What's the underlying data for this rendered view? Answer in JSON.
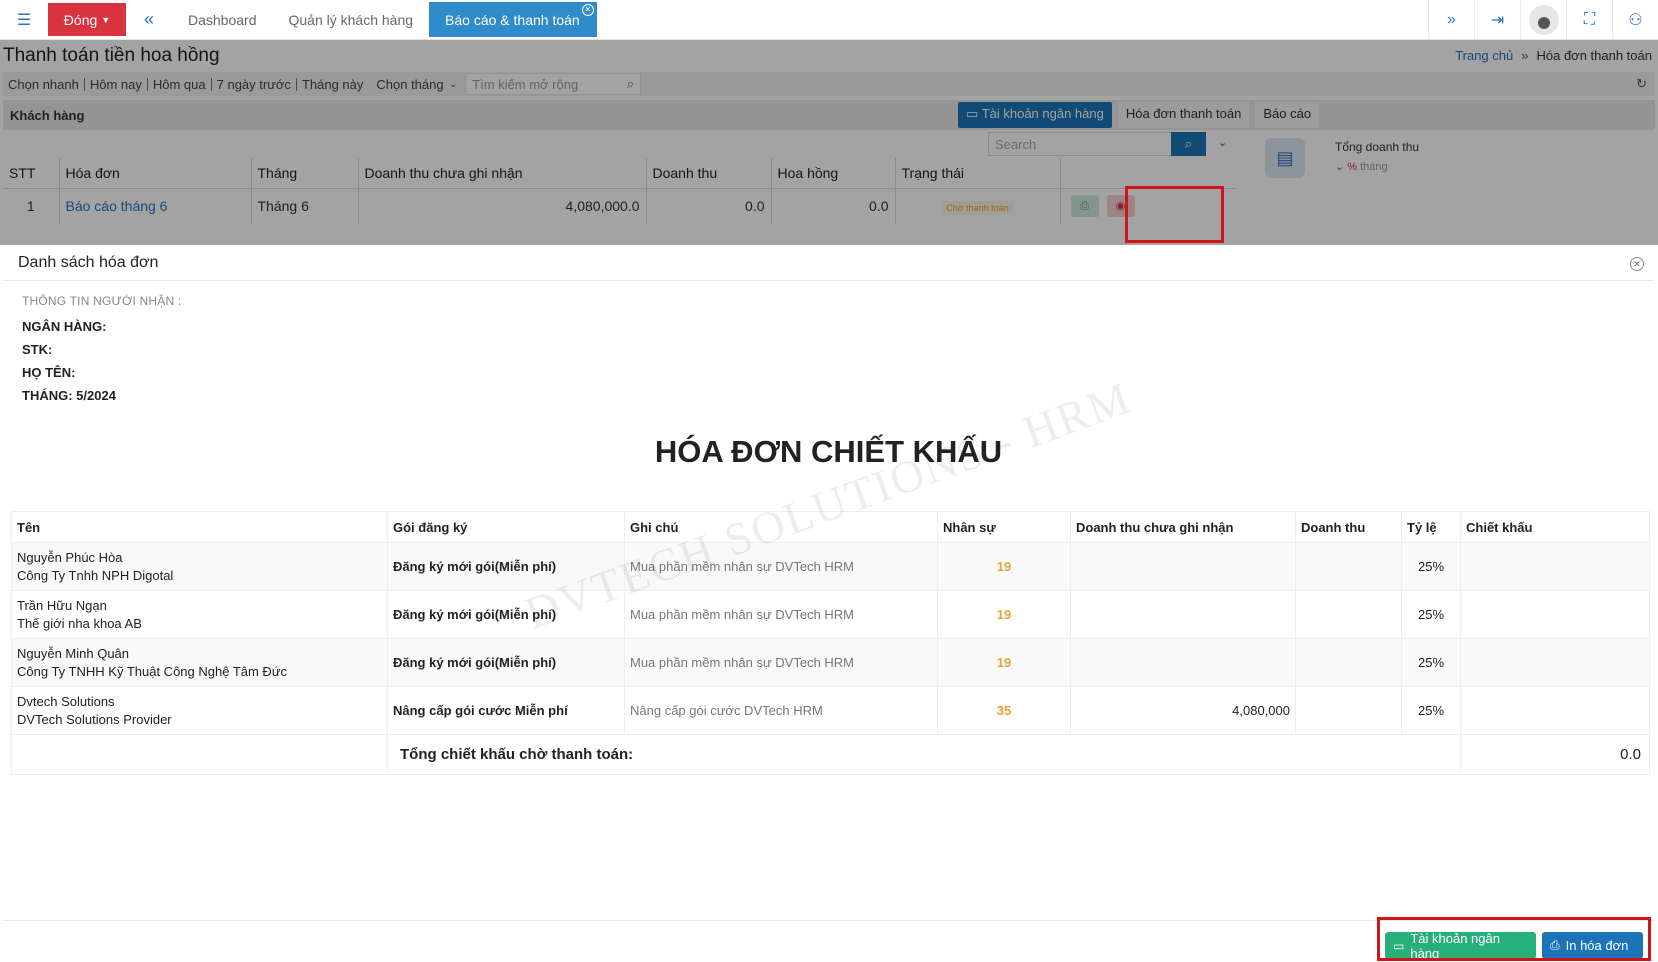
{
  "navbar": {
    "close_label": "Đóng",
    "tabs": [
      {
        "label": "Dashboard"
      },
      {
        "label": "Quản lý khách hàng"
      },
      {
        "label": "Báo cáo & thanh toán"
      }
    ],
    "icons": [
      "menu-icon",
      "double-chevron-left-icon",
      "double-chevron-right-icon",
      "logout-icon",
      "user-avatar-icon",
      "fullscreen-icon",
      "org-chart-icon"
    ]
  },
  "page": {
    "title": "Thanh toán tiền hoa hồng",
    "breadcrumb": {
      "home": "Trang chủ",
      "current": "Hóa đơn thanh toán"
    },
    "filters": {
      "quick": [
        "Chọn nhanh",
        "Hôm nay",
        "Hôm qua",
        "7 ngày trước",
        "Tháng này"
      ],
      "month_select": "Chọn tháng",
      "search_placeholder": "Tìm kiếm mở rộng"
    },
    "section_label": "Khách hàng",
    "subtabs": [
      "Tài khoản ngân hàng",
      "Hóa đơn thanh toán",
      "Báo cáo"
    ],
    "search_placeholder": "Search",
    "table": {
      "columns": [
        "STT",
        "Hóa đơn",
        "Tháng",
        "Doanh thu chưa ghi nhận",
        "Doanh thu",
        "Hoa hồng",
        "Trạng thái"
      ],
      "rows": [
        {
          "stt": "1",
          "invoice": "Báo cáo tháng 6",
          "month": "Tháng 6",
          "unrecorded": "4,080,000.0",
          "revenue": "0.0",
          "commission": "0.0",
          "status": "Chờ thanh toán"
        }
      ]
    },
    "stat": {
      "label": "Tổng doanh thu",
      "pct": "%",
      "sub": "tháng"
    }
  },
  "modal": {
    "title": "Danh sách hóa đơn",
    "recipient": {
      "heading": "THÔNG TIN NGƯỜI NHẬN :",
      "bank": "NGÂN HÀNG:",
      "account": "STK:",
      "name": "HỌ TÊN:",
      "month": "THÁNG: 5/2024"
    },
    "invoice_title": "HÓA ĐƠN CHIẾT KHẤU",
    "watermark": "DVTECH SOLUTIONS - HRM",
    "columns": [
      "Tên",
      "Gói đăng ký",
      "Ghi chú",
      "Nhân sự",
      "Doanh thu chưa ghi nhận",
      "Doanh thu",
      "Tỷ lệ",
      "Chiết khấu"
    ],
    "rows": [
      {
        "name1": "Nguyễn Phúc Hòa",
        "name2": "Công Ty Tnhh NPH Digotal",
        "package": "Đăng ký mới gói(Miễn phí)",
        "note": "Mua phần mềm nhân sự DVTech HRM",
        "staff": "19",
        "unrecorded": "",
        "revenue": "",
        "rate": "25%",
        "discount": ""
      },
      {
        "name1": "Trần Hữu Ngạn",
        "name2": "Thế giới nha khoa AB",
        "package": "Đăng ký mới gói(Miễn phí)",
        "note": "Mua phần mềm nhân sự DVTech HRM",
        "staff": "19",
        "unrecorded": "",
        "revenue": "",
        "rate": "25%",
        "discount": ""
      },
      {
        "name1": "Nguyễn Minh Quân",
        "name2": "Công Ty TNHH Kỹ Thuật Công Nghệ Tâm Đức",
        "package": "Đăng ký mới gói(Miễn phí)",
        "note": "Mua phần mềm nhân sự DVTech HRM",
        "staff": "19",
        "unrecorded": "",
        "revenue": "",
        "rate": "25%",
        "discount": ""
      },
      {
        "name1": "Dvtech Solutions",
        "name2": "DVTech Solutions Provider",
        "package": "Nâng cấp gói cước Miễn phí",
        "note": "Nâng cấp gói cước DVTech HRM",
        "staff": "35",
        "unrecorded": "4,080,000",
        "revenue": "",
        "rate": "25%",
        "discount": ""
      }
    ],
    "total_label": "Tổng chiết khấu chờ thanh toán:",
    "total_value": "0.0",
    "buttons": {
      "bank": "Tài khoản ngân hàng",
      "print": "In hóa đơn"
    }
  }
}
